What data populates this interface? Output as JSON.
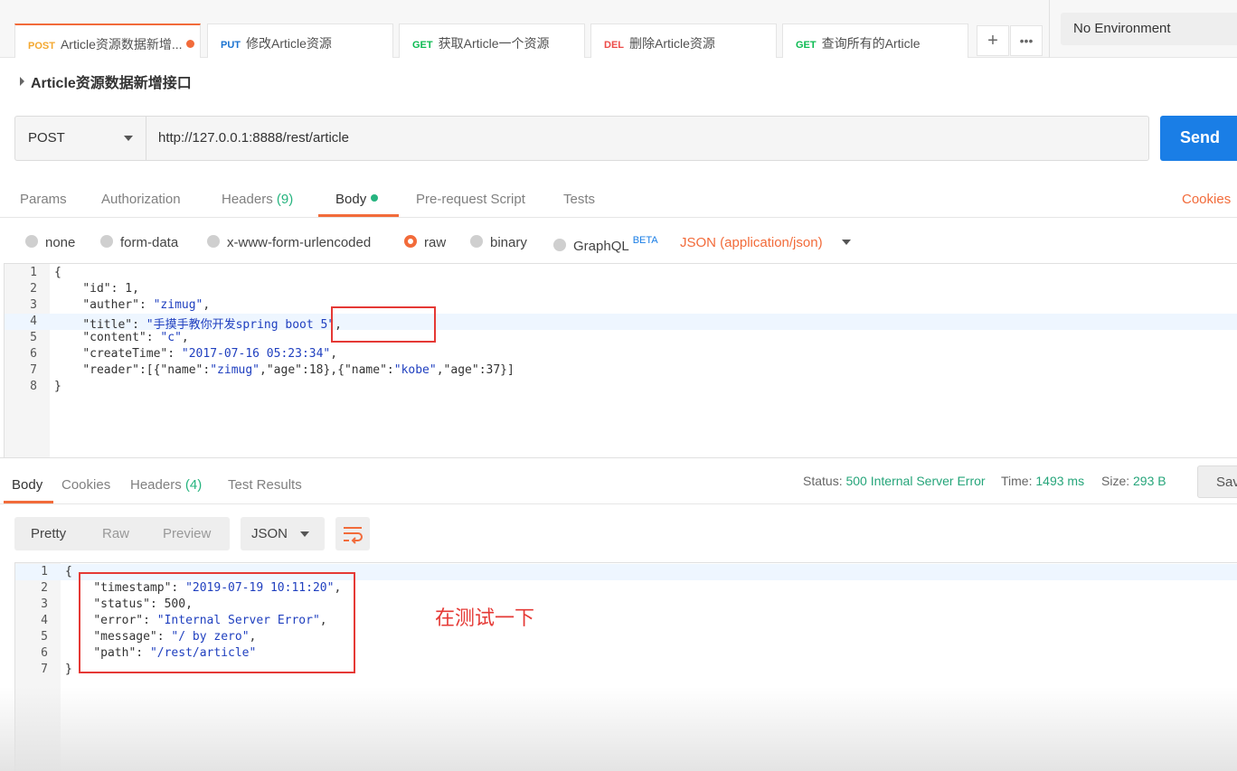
{
  "tabs": [
    {
      "method": "POST",
      "label": "Article资源数据新增..."
    },
    {
      "method": "PUT",
      "label": "修改Article资源"
    },
    {
      "method": "GET",
      "label": "获取Article一个资源"
    },
    {
      "method": "DEL",
      "label": "删除Article资源"
    },
    {
      "method": "GET",
      "label": "查询所有的Article"
    }
  ],
  "tab_actions": {
    "add": "+",
    "more": "•••"
  },
  "environment": "No Environment",
  "request_name": "Article资源数据新增接口",
  "request": {
    "method": "POST",
    "url": "http://127.0.0.1:8888/rest/article",
    "send_label": "Send"
  },
  "request_tabs": {
    "params": "Params",
    "authorization": "Authorization",
    "headers": "Headers",
    "headers_count": "(9)",
    "body": "Body",
    "prerequest": "Pre-request Script",
    "tests": "Tests",
    "cookies": "Cookies"
  },
  "body_types": {
    "none": "none",
    "form_data": "form-data",
    "urlencoded": "x-www-form-urlencoded",
    "raw": "raw",
    "binary": "binary",
    "graphql": "GraphQL",
    "beta": "BETA",
    "content_type": "JSON (application/json)"
  },
  "request_body_lines": [
    "{",
    "    \"id\": 1,",
    "    \"auther\": \"zimug\",",
    "    \"title\": \"手摸手教你开发spring boot 5\",",
    "    \"content\": \"c\",",
    "    \"createTime\": \"2017-07-16 05:23:34\",",
    "    \"reader\":[{\"name\":\"zimug\",\"age\":18},{\"name\":\"kobe\",\"age\":37}]",
    "}"
  ],
  "line_numbers": [
    "1",
    "2",
    "3",
    "4",
    "5",
    "6",
    "7",
    "8"
  ],
  "response_tabs": {
    "body": "Body",
    "cookies": "Cookies",
    "headers": "Headers",
    "headers_count": "(4)",
    "test_results": "Test Results"
  },
  "response_status": {
    "status_label": "Status:",
    "status_value": "500 Internal Server Error",
    "time_label": "Time:",
    "time_value": "1493 ms",
    "size_label": "Size:",
    "size_value": "293 B",
    "save_label": "Sav"
  },
  "response_format": {
    "pretty": "Pretty",
    "raw": "Raw",
    "preview": "Preview",
    "language": "JSON"
  },
  "response_body_lines": [
    "{",
    "    \"timestamp\": \"2019-07-19 10:11:20\",",
    "    \"status\": 500,",
    "    \"error\": \"Internal Server Error\",",
    "    \"message\": \"/ by zero\",",
    "    \"path\": \"/rest/article\"",
    "}"
  ],
  "response_line_numbers": [
    "1",
    "2",
    "3",
    "4",
    "5",
    "6",
    "7"
  ],
  "annotation": "在测试一下",
  "colors": {
    "accent": "#f26b3a",
    "send": "#1a7ee6",
    "status_ok": "#26a57a",
    "annotation": "#e53935"
  }
}
